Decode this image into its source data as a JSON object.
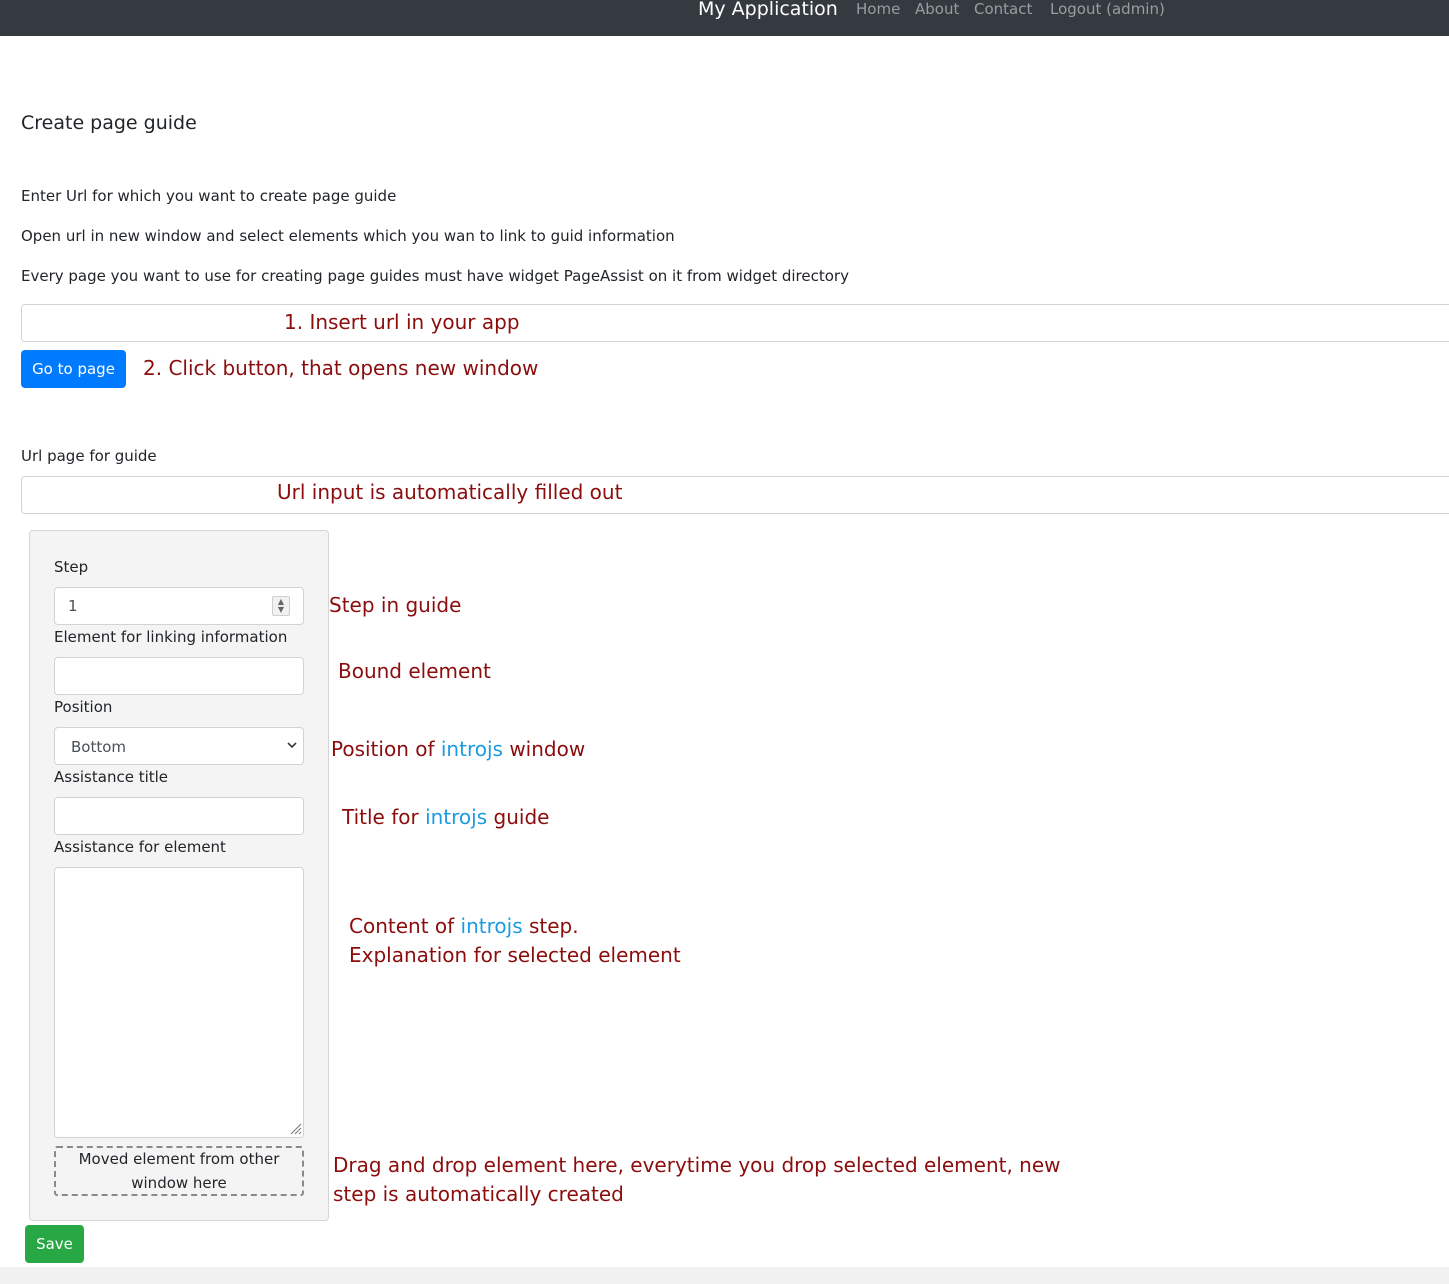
{
  "navbar": {
    "brand": "My Application",
    "links": [
      "Home",
      "About",
      "Contact",
      "Logout (admin)"
    ]
  },
  "page": {
    "title": "Create page guide",
    "instructions": [
      "Enter Url for which you want to create page guide",
      "Open url in new window and select elements which you wan to link to guid information",
      "Every page you want to use for creating page guides must have widget PageAssist on it from widget directory"
    ]
  },
  "url_input": {
    "value": "",
    "placeholder": ""
  },
  "go_button": {
    "label": "Go to page"
  },
  "url_page": {
    "label": "Url page for guide",
    "value": ""
  },
  "form": {
    "step_label": "Step",
    "step_value": "1",
    "element_label": "Element for linking information",
    "element_value": "",
    "position_label": "Position",
    "position_selected": "Bottom",
    "title_label": "Assistance title",
    "title_value": "",
    "assist_label": "Assistance for element",
    "assist_value": "",
    "dropzone_line1": "Moved element from other",
    "dropzone_line2": "window here"
  },
  "save_button": {
    "label": "Save"
  },
  "annotations": {
    "insert_url": "1. Insert url in your app",
    "click_button": "2. Click button, that opens new window",
    "url_filled": "Url input is automatically filled out",
    "step": "Step in guide",
    "bound": "Bound element",
    "position_pre": "Position of",
    "introjs": "introjs",
    "position_post": "window",
    "title_pre": "Title for",
    "title_post": "guide",
    "content_pre": "Content of",
    "content_post": "step.",
    "content_line2": "Explanation for selected element",
    "drag_line1": "Drag and drop element here, everytime you drop selected element, new",
    "drag_line2": "step is automatically created"
  },
  "colors": {
    "navbar": "#343a40",
    "primary": "#007bff",
    "success": "#28a745",
    "annotation": "#8b0d0d",
    "highlight": "#1b9be0"
  }
}
